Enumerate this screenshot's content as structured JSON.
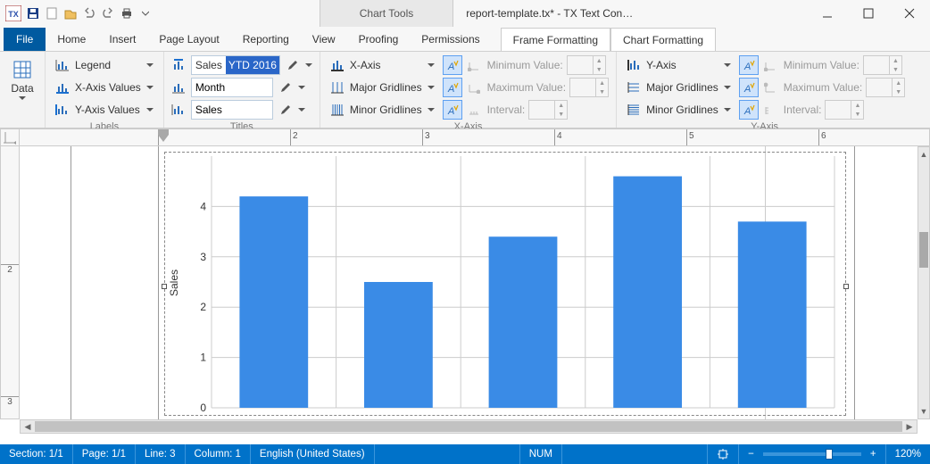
{
  "title": {
    "chart_tools": "Chart Tools",
    "doc": "report-template.tx* - TX Text Con…"
  },
  "tabs": {
    "file": "File",
    "home": "Home",
    "insert": "Insert",
    "pagelayout": "Page Layout",
    "reporting": "Reporting",
    "view": "View",
    "proofing": "Proofing",
    "permissions": "Permissions",
    "frame": "Frame Formatting",
    "chart": "Chart Formatting"
  },
  "ribbon": {
    "data": "Data",
    "labels": {
      "group": "Labels",
      "legend": "Legend",
      "xvals": "X-Axis Values",
      "yvals": "Y-Axis Values"
    },
    "titles": {
      "group": "Titles",
      "chart_prefix": "Sales",
      "chart_sel": "YTD 2016",
      "x": "Month",
      "y": "Sales"
    },
    "xaxis": {
      "group": "X-Axis",
      "xaxis": "X-Axis",
      "major": "Major Gridlines",
      "minor": "Minor Gridlines",
      "min": "Minimum Value:",
      "max": "Maximum Value:",
      "interval": "Interval:"
    },
    "yaxis": {
      "group": "Y-Axis",
      "yaxis": "Y-Axis",
      "major": "Major Gridlines",
      "minor": "Minor Gridlines",
      "min": "Minimum Value:",
      "max": "Maximum Value:",
      "interval": "Interval:"
    }
  },
  "chart_data": {
    "type": "bar",
    "title": "Sales YTD 2016",
    "xlabel": "Month",
    "ylabel": "Sales",
    "ylim": [
      0,
      5
    ],
    "yticks": [
      0,
      1,
      2,
      3,
      4
    ],
    "categories": [
      "",
      "",
      "",
      "",
      ""
    ],
    "values": [
      4.2,
      2.5,
      3.4,
      4.6,
      3.7
    ],
    "bar_color": "#3a8be6"
  },
  "status": {
    "section": "Section: 1/1",
    "page": "Page: 1/1",
    "line": "Line: 3",
    "column": "Column: 1",
    "lang": "English (United States)",
    "num": "NUM",
    "zoom": "120%"
  }
}
